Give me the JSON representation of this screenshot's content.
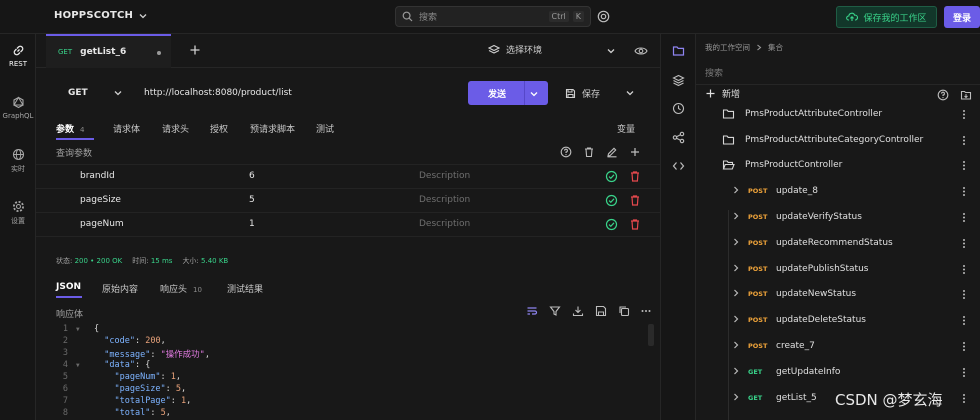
{
  "top_bar": {
    "brand": "HOPPSCOTCH",
    "search_placeholder": "搜索",
    "shortcut_ctrl": "Ctrl",
    "shortcut_k": "K",
    "save_workspace_label": "保存我的工作区",
    "login_label": "登录"
  },
  "left_nav": {
    "items": [
      {
        "label": "REST",
        "icon": "link-icon"
      },
      {
        "label": "GraphQL",
        "icon": "graphql-icon"
      },
      {
        "label": "实时",
        "icon": "globe-icon"
      },
      {
        "label": "设置",
        "icon": "gear-icon"
      }
    ]
  },
  "request_tab": {
    "method": "GET",
    "title": "getList_6"
  },
  "environment": {
    "label": "选择环境"
  },
  "request": {
    "method": "GET",
    "url": "http://localhost:8080/product/list",
    "send_label": "发送",
    "save_label": "保存"
  },
  "param_tabs": {
    "items": [
      "参数",
      "请求体",
      "请求头",
      "授权",
      "预请求脚本",
      "测试"
    ],
    "params_count": "4",
    "variables_label": "变量"
  },
  "query_params": {
    "label": "查询参数",
    "rows": [
      {
        "key": "brandId",
        "value": "6",
        "description": "Description"
      },
      {
        "key": "pageSize",
        "value": "5",
        "description": "Description"
      },
      {
        "key": "pageNum",
        "value": "1",
        "description": "Description"
      }
    ]
  },
  "status": {
    "status_label": "状态:",
    "status_value": "200 • 200 OK",
    "time_label": "时间:",
    "time_value": "15 ms",
    "size_label": "大小:",
    "size_value": "5.40 KB"
  },
  "response_tabs": {
    "items": [
      "JSON",
      "原始内容",
      "响应头",
      "测试结果"
    ],
    "headers_count": "10",
    "body_label": "响应体"
  },
  "code_lines": [
    {
      "n": "1",
      "fold": "▼",
      "html": "{"
    },
    {
      "n": "2",
      "fold": "",
      "html": "  <span class=\"k2\">\"code\"</span>: <span class=\"n2\">200</span>,"
    },
    {
      "n": "3",
      "fold": "",
      "html": "  <span class=\"k2\">\"message\"</span>: <span class=\"s2\">\"操作成功\"</span>,"
    },
    {
      "n": "4",
      "fold": "▼",
      "html": "  <span class=\"k2\">\"data\"</span>: {"
    },
    {
      "n": "5",
      "fold": "",
      "html": "    <span class=\"k2\">\"pageNum\"</span>: <span class=\"n2\">1</span>,"
    },
    {
      "n": "6",
      "fold": "",
      "html": "    <span class=\"k2\">\"pageSize\"</span>: <span class=\"n2\">5</span>,"
    },
    {
      "n": "7",
      "fold": "",
      "html": "    <span class=\"k2\">\"totalPage\"</span>: <span class=\"n2\">1</span>,"
    },
    {
      "n": "8",
      "fold": "",
      "html": "    <span class=\"k2\">\"total\"</span>: <span class=\"n2\">5</span>,"
    }
  ],
  "collections": {
    "breadcrumb_root": "我的工作空间",
    "breadcrumb_current": "集合",
    "search_placeholder": "搜索",
    "new_label": "新增",
    "folders": [
      {
        "name": "PmsProductAttributeController",
        "open": false
      },
      {
        "name": "PmsProductAttributeCategoryController",
        "open": false
      },
      {
        "name": "PmsProductController",
        "open": true
      }
    ],
    "requests": [
      {
        "method": "POST",
        "name": "update_8"
      },
      {
        "method": "POST",
        "name": "updateVerifyStatus"
      },
      {
        "method": "POST",
        "name": "updateRecommendStatus"
      },
      {
        "method": "POST",
        "name": "updatePublishStatus"
      },
      {
        "method": "POST",
        "name": "updateNewStatus"
      },
      {
        "method": "POST",
        "name": "updateDeleteStatus"
      },
      {
        "method": "POST",
        "name": "create_7"
      },
      {
        "method": "GET",
        "name": "getUpdateInfo"
      },
      {
        "method": "GET",
        "name": "getList_5"
      }
    ]
  },
  "watermark": "CSDN @梦玄海",
  "colors": {
    "accent": "#6b5ce7",
    "get": "#39d38a",
    "post": "#f0a43a",
    "danger": "#e5484d"
  }
}
